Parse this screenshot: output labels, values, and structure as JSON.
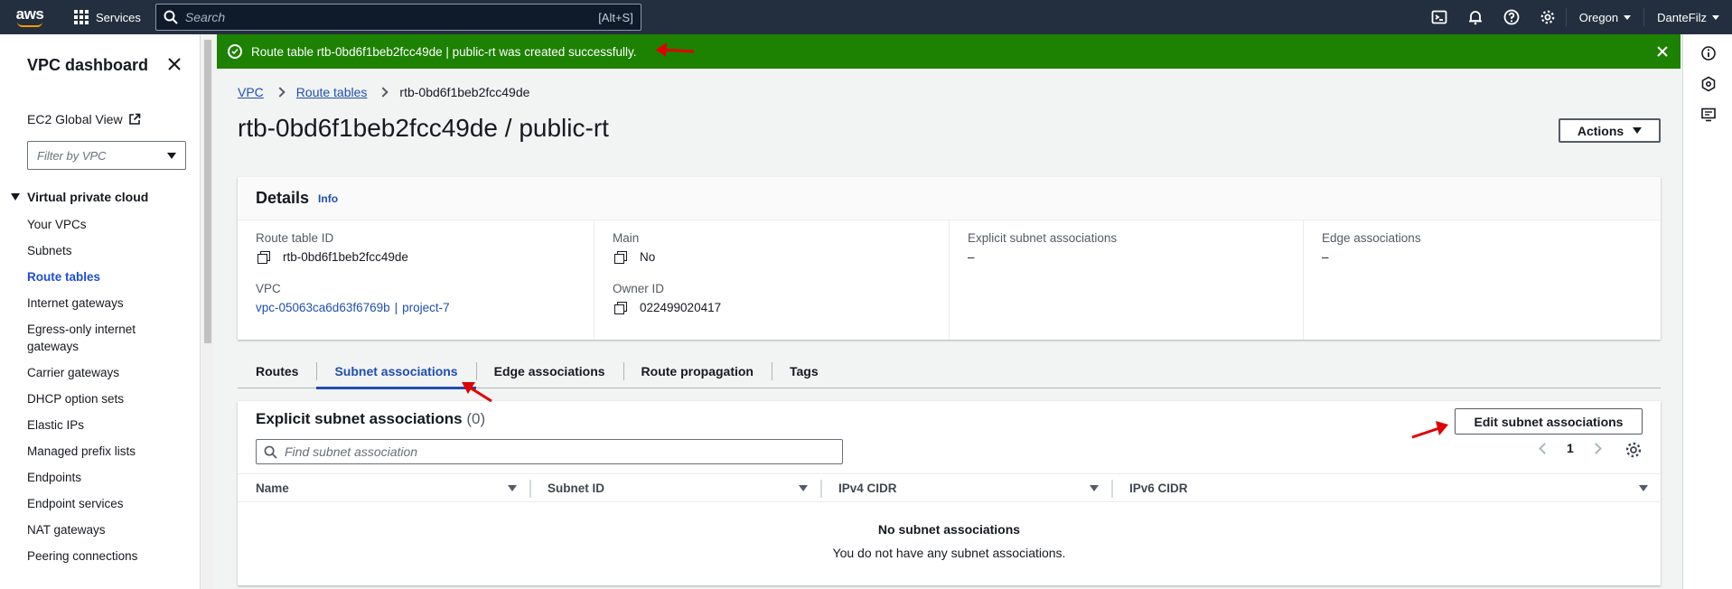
{
  "topnav": {
    "logo": "aws",
    "services_label": "Services",
    "search_placeholder": "Search",
    "search_shortcut": "[Alt+S]",
    "region": "Oregon",
    "user": "DanteFilz"
  },
  "sidebar": {
    "title": "VPC dashboard",
    "global_view": "EC2 Global View",
    "filter_placeholder": "Filter by VPC",
    "section": "Virtual private cloud",
    "items": [
      {
        "label": "Your VPCs"
      },
      {
        "label": "Subnets"
      },
      {
        "label": "Route tables",
        "active": true
      },
      {
        "label": "Internet gateways"
      },
      {
        "label": "Egress-only internet gateways"
      },
      {
        "label": "Carrier gateways"
      },
      {
        "label": "DHCP option sets"
      },
      {
        "label": "Elastic IPs"
      },
      {
        "label": "Managed prefix lists"
      },
      {
        "label": "Endpoints"
      },
      {
        "label": "Endpoint services"
      },
      {
        "label": "NAT gateways"
      },
      {
        "label": "Peering connections"
      }
    ]
  },
  "banner": {
    "message": "Route table rtb-0bd6f1beb2fcc49de | public-rt was created successfully.",
    "color": "#1d8102"
  },
  "breadcrumb": {
    "vpc": "VPC",
    "route_tables": "Route tables",
    "current": "rtb-0bd6f1beb2fcc49de"
  },
  "page": {
    "title": "rtb-0bd6f1beb2fcc49de / public-rt",
    "actions_label": "Actions"
  },
  "details": {
    "title": "Details",
    "info": "Info",
    "route_table_id_label": "Route table ID",
    "route_table_id": "rtb-0bd6f1beb2fcc49de",
    "vpc_label": "VPC",
    "vpc_id": "vpc-05063ca6d63f6769b",
    "vpc_sep": "|",
    "vpc_name": "project-7",
    "main_label": "Main",
    "main_value": "No",
    "owner_label": "Owner ID",
    "owner_value": "022499020417",
    "explicit_label": "Explicit subnet associations",
    "explicit_value": "–",
    "edge_label": "Edge associations",
    "edge_value": "–"
  },
  "tabs": [
    {
      "label": "Routes"
    },
    {
      "label": "Subnet associations",
      "active": true
    },
    {
      "label": "Edge associations"
    },
    {
      "label": "Route propagation"
    },
    {
      "label": "Tags"
    }
  ],
  "subnet_section": {
    "title": "Explicit subnet associations",
    "count": "(0)",
    "edit_button": "Edit subnet associations",
    "find_placeholder": "Find subnet association",
    "page": "1",
    "columns": [
      "Name",
      "Subnet ID",
      "IPv4 CIDR",
      "IPv6 CIDR"
    ],
    "empty_title": "No subnet associations",
    "empty_desc": "You do not have any subnet associations."
  },
  "colors": {
    "topnav": "#232f3e",
    "link": "#1f4fb0",
    "annotation_arrow": "#e00000"
  }
}
